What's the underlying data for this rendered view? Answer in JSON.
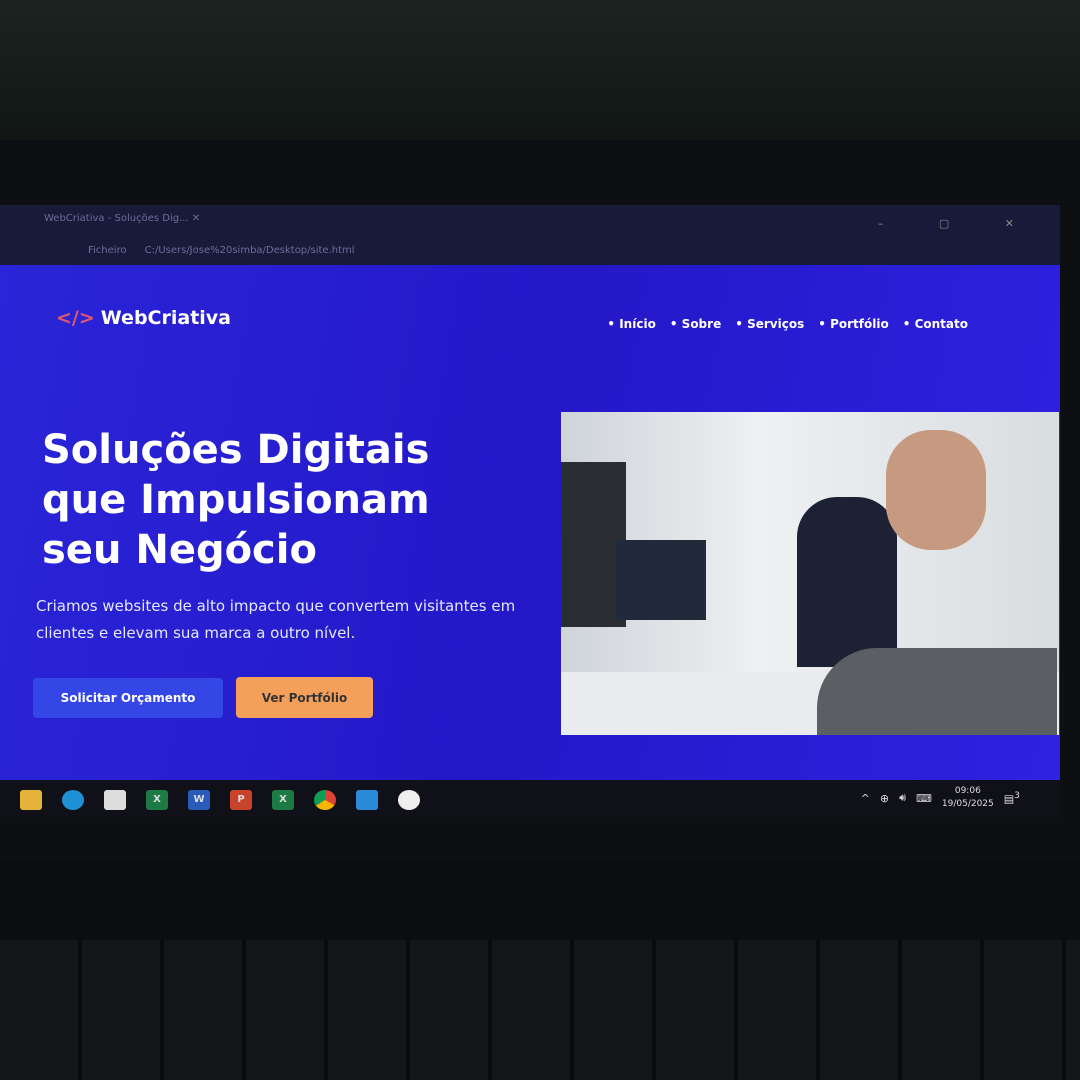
{
  "browser": {
    "tab_title": "WebCriativa - Soluções Dig...",
    "address_prefix": "Ficheiro",
    "address": "C:/Users/Jose%20simba/Desktop/site.html",
    "window_controls": "– ▢ ✕"
  },
  "site": {
    "logo_code": "</>",
    "logo_text": "WebCriativa",
    "nav": [
      "Início",
      "Sobre",
      "Serviços",
      "Portfólio",
      "Contato"
    ],
    "headline": "Soluções Digitais que Impulsionam seu Negócio",
    "subtitle": "Criamos websites de alto impacto que convertem visitantes em clientes e elevam sua marca a outro nível.",
    "primary_button": "Solicitar Orçamento",
    "secondary_button": "Ver Portfólio"
  },
  "taskbar": {
    "apps": [
      "file-explorer",
      "edge",
      "store",
      "excel",
      "word",
      "powerpoint",
      "excel",
      "chrome",
      "vscode",
      "app"
    ],
    "time": "09:06",
    "date": "19/05/2025",
    "notifications": "3"
  },
  "colors": {
    "accent": "#2a20d6",
    "button_primary": "#3447e6",
    "button_secondary": "#f5a05a",
    "logo_code": "#e0566a"
  }
}
